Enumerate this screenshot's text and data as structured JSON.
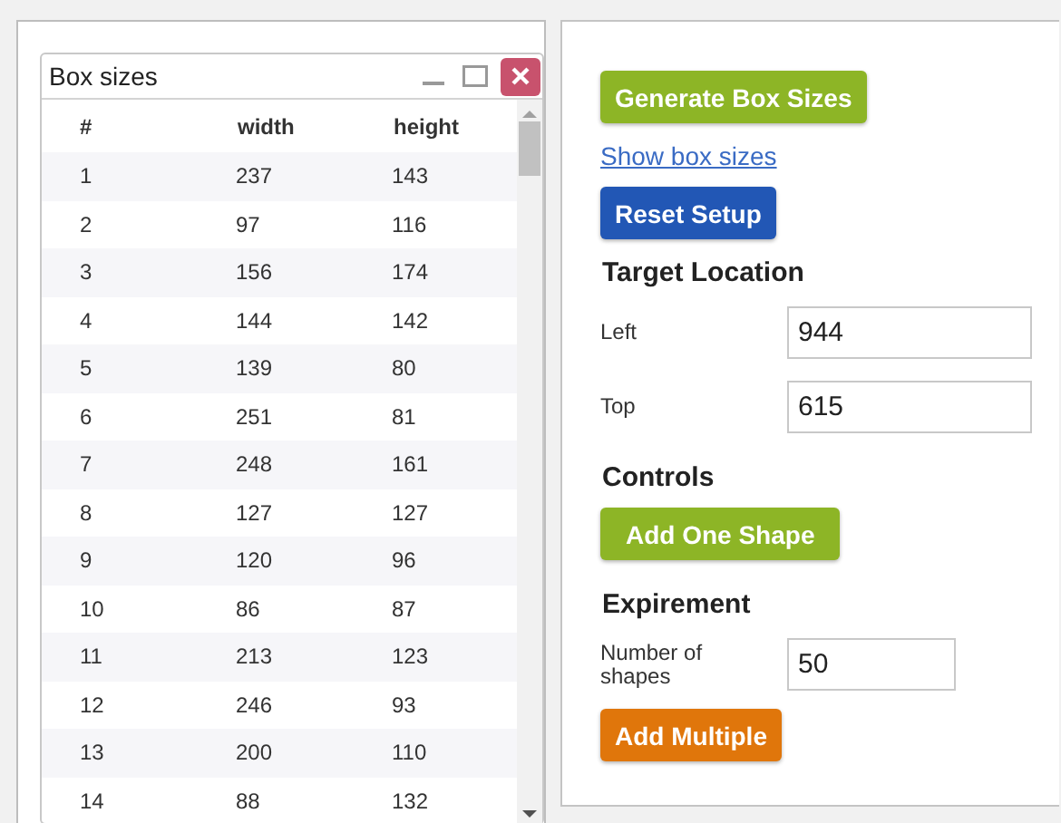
{
  "dialog": {
    "title": "Box sizes",
    "columns": [
      "#",
      "width",
      "height"
    ],
    "rows": [
      [
        "1",
        "237",
        "143"
      ],
      [
        "2",
        "97",
        "116"
      ],
      [
        "3",
        "156",
        "174"
      ],
      [
        "4",
        "144",
        "142"
      ],
      [
        "5",
        "139",
        "80"
      ],
      [
        "6",
        "251",
        "81"
      ],
      [
        "7",
        "248",
        "161"
      ],
      [
        "8",
        "127",
        "127"
      ],
      [
        "9",
        "120",
        "96"
      ],
      [
        "10",
        "86",
        "87"
      ],
      [
        "11",
        "213",
        "123"
      ],
      [
        "12",
        "246",
        "93"
      ],
      [
        "13",
        "200",
        "110"
      ],
      [
        "14",
        "88",
        "132"
      ]
    ]
  },
  "panel": {
    "items": [
      {
        "kind": "button",
        "label": "Generate Box Sizes",
        "color": "#8db526"
      },
      {
        "kind": "link",
        "label": "Show box sizes"
      },
      {
        "kind": "button",
        "label": "Reset Setup",
        "color": "#2257b5"
      },
      {
        "kind": "heading",
        "label": "Target Location"
      },
      {
        "kind": "field",
        "label": "Left",
        "value": "944"
      },
      {
        "kind": "field",
        "label": "Top",
        "value": "615"
      },
      {
        "kind": "heading",
        "label": "Controls"
      },
      {
        "kind": "button",
        "label": "Add One Shape",
        "color": "#8db526"
      },
      {
        "kind": "heading",
        "label": "Expirement"
      },
      {
        "kind": "short-field",
        "label": "Number of shapes",
        "value": "50"
      },
      {
        "kind": "button",
        "label": "Add Multiple",
        "color": "#e0760b"
      }
    ]
  }
}
